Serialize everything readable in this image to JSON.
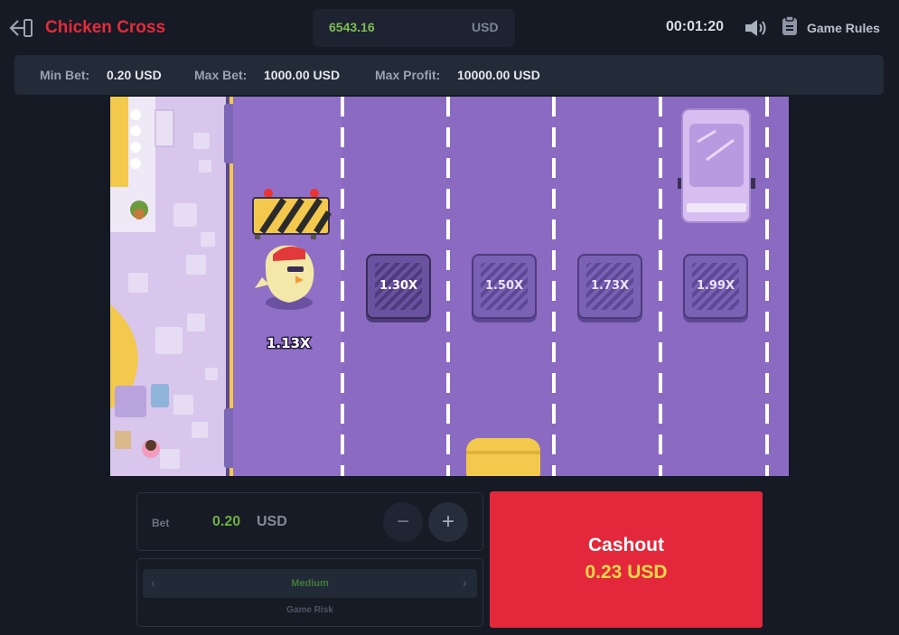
{
  "header": {
    "title": "Chicken Cross",
    "balance": "6543.16",
    "balance_currency": "USD",
    "timer": "00:01:20",
    "rules_label": "Game Rules"
  },
  "limits": {
    "min_label": "Min Bet:",
    "min_value": "0.20 USD",
    "max_label": "Max Bet:",
    "max_value": "1000.00 USD",
    "profit_label": "Max Profit:",
    "profit_value": "10000.00 USD"
  },
  "game": {
    "current_multiplier": "1.13X",
    "lanes": [
      {
        "multiplier": "1.30X"
      },
      {
        "multiplier": "1.50X"
      },
      {
        "multiplier": "1.73X"
      },
      {
        "multiplier": "1.99X"
      }
    ],
    "colors": {
      "road": "#8a6bc1",
      "lane_line": "#ffffff",
      "cashout": "#e3283b",
      "accent_green": "#6fb043"
    }
  },
  "bet": {
    "label": "Bet",
    "value": "0.20",
    "currency": "USD",
    "minus_label": "−",
    "plus_label": "+"
  },
  "risk": {
    "value": "Medium",
    "caption": "Game Risk",
    "left_arrow": "‹",
    "right_arrow": "›"
  },
  "cashout": {
    "label": "Cashout",
    "amount": "0.23",
    "currency": "USD"
  },
  "icons": {
    "back": "exit-arrow-icon",
    "sound": "speaker-icon",
    "rules": "document-icon",
    "barrier": "road-barrier-icon",
    "chicken": "chicken-icon",
    "car": "car-icon",
    "manhole": "manhole-icon"
  }
}
